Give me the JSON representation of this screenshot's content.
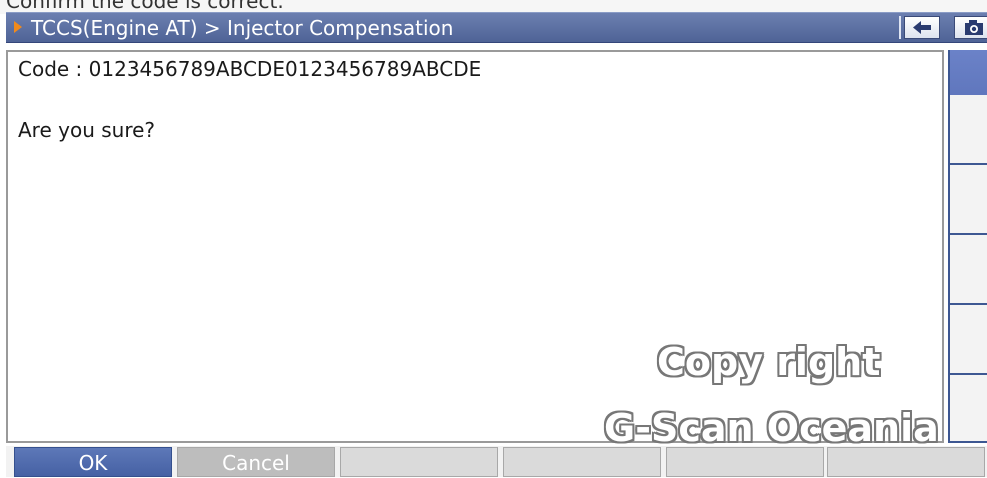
{
  "top_clipped_text": "Confirm the code is correct.",
  "titlebar": {
    "title": "TCCS(Engine AT) > Injector Compensation",
    "back_icon": "back-arrow-icon",
    "camera_icon": "camera-icon",
    "colors": {
      "bar": "#4f6396",
      "accent": "#f08a1c"
    }
  },
  "content": {
    "code_line": "Code : 0123456789ABCDE0123456789ABCDE",
    "prompt": "Are you sure?"
  },
  "watermark": {
    "line1": "Copy right",
    "line2": "G-Scan Oceania"
  },
  "softkeys": [
    {
      "label": "OK"
    },
    {
      "label": "Cancel"
    },
    {
      "label": ""
    },
    {
      "label": ""
    },
    {
      "label": ""
    },
    {
      "label": ""
    }
  ]
}
